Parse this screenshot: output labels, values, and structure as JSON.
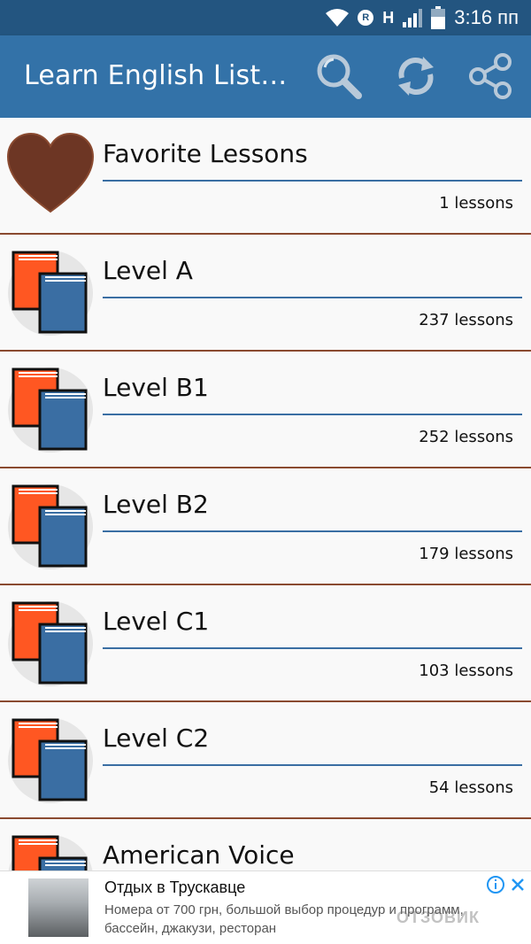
{
  "status_bar": {
    "time": "3:16 пп",
    "network_label": "H",
    "roaming_label": "R",
    "icons": [
      "wifi-icon",
      "roaming-icon",
      "signal-icon",
      "battery-icon"
    ]
  },
  "toolbar": {
    "title": "Learn English List…",
    "actions": [
      "search-icon",
      "refresh-icon",
      "share-icon"
    ],
    "color": "#3372a8"
  },
  "lessons": [
    {
      "name": "Favorite Lessons",
      "count": "1 lessons",
      "icon": "heart-icon"
    },
    {
      "name": "Level A",
      "count": "237 lessons",
      "icon": "books-icon"
    },
    {
      "name": "Level B1",
      "count": "252 lessons",
      "icon": "books-icon"
    },
    {
      "name": "Level B2",
      "count": "179 lessons",
      "icon": "books-icon"
    },
    {
      "name": "Level C1",
      "count": "103 lessons",
      "icon": "books-icon"
    },
    {
      "name": "Level C2",
      "count": "54 lessons",
      "icon": "books-icon"
    },
    {
      "name": "American Voice",
      "count": "",
      "icon": "books-icon"
    }
  ],
  "ad": {
    "title": "Отдых в Трускавце",
    "text": "Номера от 700 грн, большой выбор процедур и программ, бассейн, джакузи, ресторан",
    "watermark": "ОТЗОВИК"
  }
}
